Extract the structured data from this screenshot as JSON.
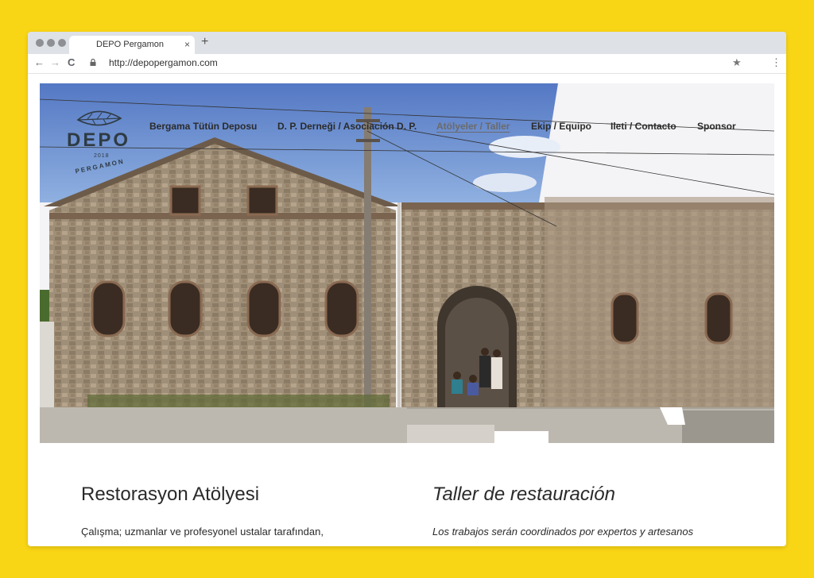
{
  "browser": {
    "tab_title": "DEPO Pergamon",
    "tab_close": "×",
    "new_tab": "+",
    "url": "http://depopergamon.com",
    "nav_back": "←",
    "nav_forward": "→",
    "nav_reload": "C",
    "bookmark": "★",
    "menu": "⋮"
  },
  "logo": {
    "word": "DEPO",
    "year": "2018",
    "arc": "PERGAMON"
  },
  "nav": {
    "items": [
      {
        "label": "Bergama Tütün Deposu",
        "active": false
      },
      {
        "label": "D. P. Derneği / Asociación D. P.",
        "active": false
      },
      {
        "label": "Atölyeler / Taller",
        "active": true
      },
      {
        "label": "Ekip / Equipo",
        "active": false
      },
      {
        "label": "Ileti / Contacto",
        "active": false
      },
      {
        "label": "Sponsor",
        "active": false
      }
    ]
  },
  "content": {
    "left_title": "Restorasyon Atölyesi",
    "left_text": "Çalışma; uzmanlar ve profesyonel ustalar tarafından,",
    "right_title": "Taller de restauración",
    "right_text": "Los trabajos serán coordinados por expertos y artesanos"
  },
  "colors": {
    "frame": "#f9d615",
    "sky": "#6a8ed3",
    "stone": "#9a8870"
  }
}
